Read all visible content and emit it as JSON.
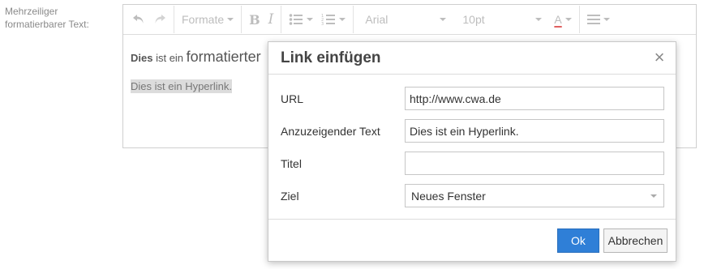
{
  "field": {
    "label": "Mehrzeiliger formatierbarer Text:"
  },
  "toolbar": {
    "undo_icon": "undo-icon",
    "redo_icon": "redo-icon",
    "formats_label": "Formate",
    "bold_label": "B",
    "italic_label": "I",
    "bullet_list_icon": "bullet-list-icon",
    "numbered_list_icon": "numbered-list-icon",
    "font_family": "Arial",
    "font_size": "10pt",
    "text_color_label": "A",
    "text_color_underline": "#e06060",
    "align_icon": "align-icon"
  },
  "content": {
    "line1_bold": "Dies",
    "line1_mid": " ist ein ",
    "line1_big": "formatierter",
    "line2": "Dies ist ein Hyperlink."
  },
  "dialog": {
    "title": "Link einfügen",
    "close_icon": "close-icon",
    "url_label": "URL",
    "url_value": "http://www.cwa.de",
    "text_label": "Anzuzeigender Text",
    "text_value": "Dies ist ein Hyperlink.",
    "title_label": "Titel",
    "title_value": "",
    "target_label": "Ziel",
    "target_value": "Neues Fenster",
    "ok_label": "Ok",
    "cancel_label": "Abbrechen",
    "ok_color": "#2f7fd7"
  }
}
